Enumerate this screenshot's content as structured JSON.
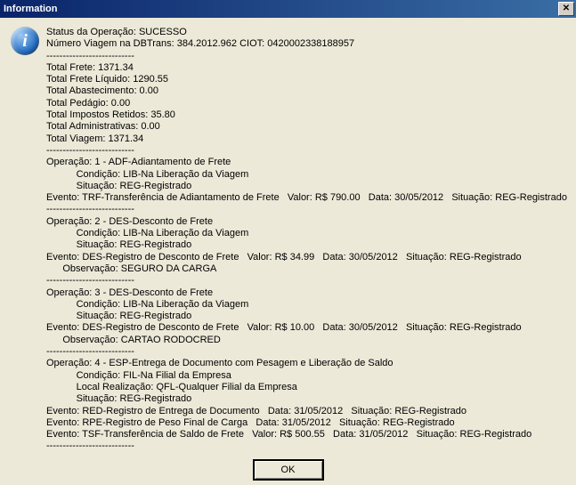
{
  "window": {
    "title": "Information"
  },
  "status": {
    "label": "Status da Operação:",
    "value": "SUCESSO",
    "viagem_label": "Número Viagem na DBTrans:",
    "viagem_num": "384.2012.962",
    "ciot_label": "CIOT:",
    "ciot": "0420002338188957"
  },
  "sep": "---------------------------",
  "totals": {
    "frete_label": "Total Frete:",
    "frete": "1371.34",
    "liquido_label": "Total Frete Líquido:",
    "liquido": "1290.55",
    "abast_label": "Total Abastecimento:",
    "abast": "0.00",
    "pedagio_label": "Total Pedágio:",
    "pedagio": "0.00",
    "impostos_label": "Total Impostos Retidos:",
    "impostos": "35.80",
    "admin_label": "Total Administrativas:",
    "admin": "0.00",
    "viagem_label": "Total Viagem:",
    "viagem": "1371.34"
  },
  "lbl": {
    "operacao": "Operação:",
    "condicao": "Condição:",
    "situacao": "Situação:",
    "local": "Local Realização:",
    "observ": "Observação:",
    "evento": "Evento:",
    "valor": "Valor:",
    "data": "Data:"
  },
  "ops": [
    {
      "num": "1",
      "desc": "ADF-Adiantamento de Frete",
      "condicao": "LIB-Na Liberação da Viagem",
      "situacao": "REG-Registrado",
      "eventos": [
        {
          "desc": "TRF-Transferência de Adiantamento de Frete",
          "valor": "R$ 790.00",
          "data": "30/05/2012",
          "situ": "REG-Registrado"
        }
      ]
    },
    {
      "num": "2",
      "desc": "DES-Desconto de Frete",
      "condicao": "LIB-Na Liberação da Viagem",
      "situacao": "REG-Registrado",
      "eventos": [
        {
          "desc": "DES-Registro de Desconto de Frete",
          "valor": "R$ 34.99",
          "data": "30/05/2012",
          "situ": "REG-Registrado"
        }
      ],
      "observ": "SEGURO DA CARGA"
    },
    {
      "num": "3",
      "desc": "DES-Desconto de Frete",
      "condicao": "LIB-Na Liberação da Viagem",
      "situacao": "REG-Registrado",
      "eventos": [
        {
          "desc": "DES-Registro de Desconto de Frete",
          "valor": "R$ 10.00",
          "data": "30/05/2012",
          "situ": "REG-Registrado"
        }
      ],
      "observ": "CARTAO RODOCRED"
    },
    {
      "num": "4",
      "desc": "ESP-Entrega de Documento com Pesagem e Liberação de Saldo",
      "condicao": "FIL-Na Filial da Empresa",
      "local": "QFL-Qualquer Filial da Empresa",
      "situacao": "REG-Registrado",
      "eventos": [
        {
          "desc": "RED-Registro de Entrega de Documento",
          "data": "31/05/2012",
          "situ": "REG-Registrado"
        },
        {
          "desc": "RPE-Registro de Peso Final de Carga",
          "data": "31/05/2012",
          "situ": "REG-Registrado"
        },
        {
          "desc": "TSF-Transferência de Saldo de Frete",
          "valor": "R$ 500.55",
          "data": "31/05/2012",
          "situ": "REG-Registrado"
        }
      ]
    }
  ],
  "buttons": {
    "ok": "OK"
  }
}
